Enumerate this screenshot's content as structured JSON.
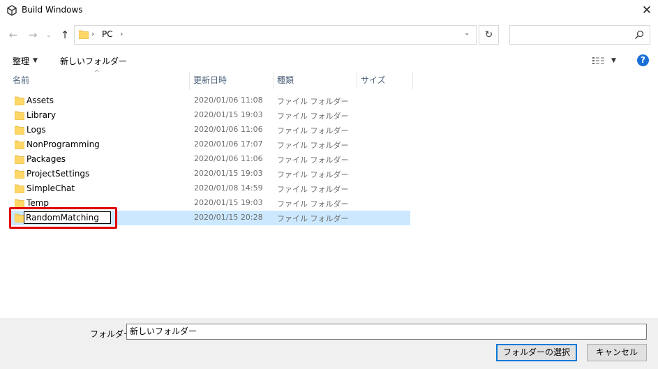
{
  "window": {
    "title": "Build Windows",
    "close_glyph": "✕"
  },
  "nav": {
    "back_glyph": "←",
    "forward_glyph": "→",
    "history_glyph": "⌄",
    "up_glyph": "↑"
  },
  "address": {
    "separator": "›",
    "location": "PC",
    "dropdown_glyph": "⌄"
  },
  "refresh_glyph": "↻",
  "search": {
    "placeholder": ""
  },
  "toolbar": {
    "organize_label": "整理",
    "organize_caret": "▼",
    "new_folder_label": "新しいフォルダー",
    "view_caret": "▼",
    "help_label": "?"
  },
  "columns": {
    "name": "名前",
    "modified": "更新日時",
    "type": "種類",
    "size": "サイズ",
    "sort_caret": "^"
  },
  "rows": [
    {
      "name": "Assets",
      "modified": "2020/01/06 11:08",
      "type": "ファイル フォルダー"
    },
    {
      "name": "Library",
      "modified": "2020/01/15 19:03",
      "type": "ファイル フォルダー"
    },
    {
      "name": "Logs",
      "modified": "2020/01/06 11:06",
      "type": "ファイル フォルダー"
    },
    {
      "name": "NonProgramming",
      "modified": "2020/01/06 17:07",
      "type": "ファイル フォルダー"
    },
    {
      "name": "Packages",
      "modified": "2020/01/06 11:06",
      "type": "ファイル フォルダー"
    },
    {
      "name": "ProjectSettings",
      "modified": "2020/01/15 19:03",
      "type": "ファイル フォルダー"
    },
    {
      "name": "SimpleChat",
      "modified": "2020/01/08 14:59",
      "type": "ファイル フォルダー"
    },
    {
      "name": "Temp",
      "modified": "2020/01/15 19:03",
      "type": "ファイル フォルダー"
    },
    {
      "name": "RandomMatching",
      "modified": "2020/01/15 20:28",
      "type": "ファイル フォルダー"
    }
  ],
  "footer": {
    "folder_label": "フォルダー:",
    "folder_value": "新しいフォルダー",
    "select_button": "フォルダーの選択",
    "cancel_button": "キャンセル"
  },
  "colors": {
    "selection": "#cce8ff",
    "highlight_box": "#e00000",
    "accent": "#0078d7",
    "folder": "#ffd766"
  }
}
